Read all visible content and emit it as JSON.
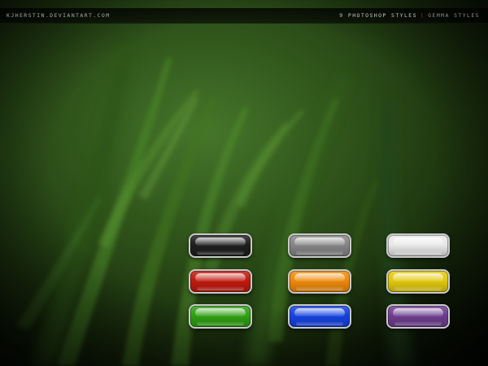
{
  "header": {
    "site": "kjherstin.deviantart.com",
    "title": "9 photoshop styles",
    "separator": "|",
    "subtitle": "gemma styles"
  },
  "colors": {
    "background": "#1f3a10",
    "bar": "#050505",
    "accent": "#b22d2d"
  },
  "buttons": [
    {
      "name": "black",
      "color": "#1f1f1f"
    },
    {
      "name": "grey",
      "color": "#868686"
    },
    {
      "name": "white",
      "color": "#e8e8e8"
    },
    {
      "name": "red",
      "color": "#c01a0f"
    },
    {
      "name": "orange",
      "color": "#ef8a0a"
    },
    {
      "name": "yellow",
      "color": "#e2c90e"
    },
    {
      "name": "green",
      "color": "#2fa012"
    },
    {
      "name": "blue",
      "color": "#1643e0"
    },
    {
      "name": "purple",
      "color": "#6e3e8f"
    }
  ]
}
